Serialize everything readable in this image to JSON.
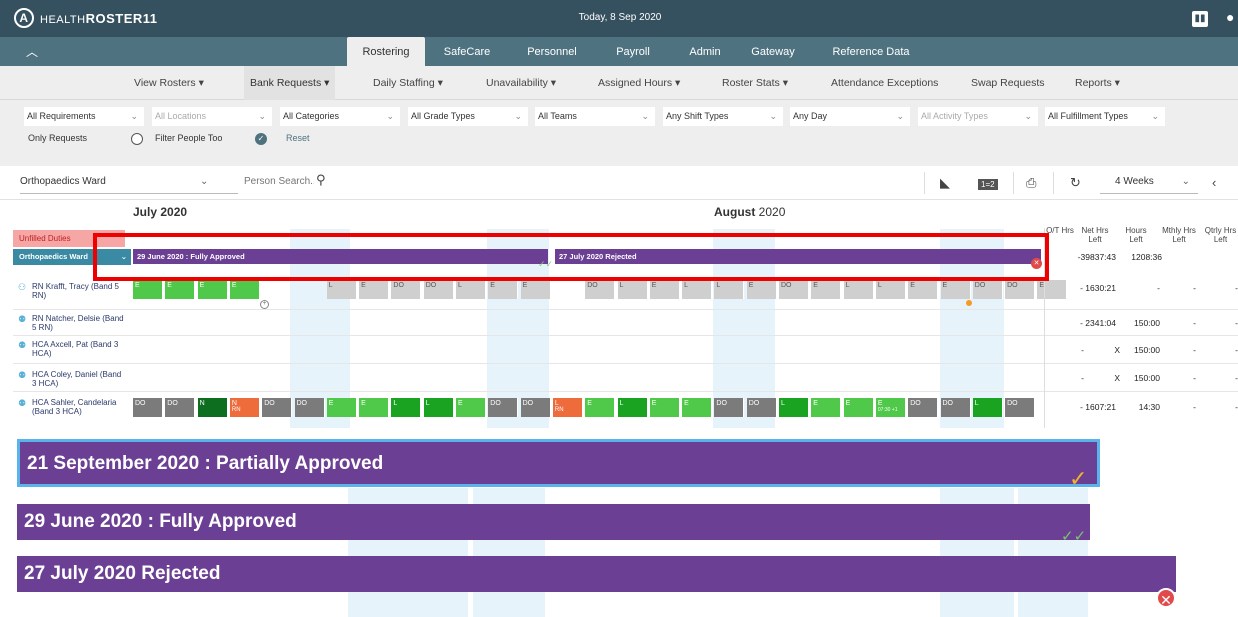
{
  "app": {
    "brand": "HEALTHROSTER11",
    "brand_health": "HEALTH",
    "brand_roster": "ROSTER",
    "brand_num": "11",
    "logo_letter": "A",
    "today": "Today, 8 Sep 2020"
  },
  "tabs": [
    {
      "label": "Rostering",
      "active": true
    },
    {
      "label": "SafeCare"
    },
    {
      "label": "Personnel"
    },
    {
      "label": "Payroll"
    },
    {
      "label": "Admin"
    },
    {
      "label": "Gateway"
    },
    {
      "label": "Reference Data"
    }
  ],
  "submenu": [
    {
      "label": "View Rosters",
      "dropdown": true,
      "active": true
    },
    {
      "label": "Bank Requests",
      "dropdown": true
    },
    {
      "label": "Daily Staffing",
      "dropdown": true
    },
    {
      "label": "Unavailability",
      "dropdown": true
    },
    {
      "label": "Assigned Hours",
      "dropdown": true
    },
    {
      "label": "Roster Stats",
      "dropdown": true
    },
    {
      "label": "Attendance Exceptions"
    },
    {
      "label": "Swap Requests"
    },
    {
      "label": "Reports",
      "dropdown": true
    }
  ],
  "filters": {
    "requirements": "All Requirements",
    "locations": "All Locations",
    "categories": "All Categories",
    "grade_types": "All Grade Types",
    "teams": "All Teams",
    "shift_types": "Any Shift Types",
    "day": "Any Day",
    "activity_types": "All Activity Types",
    "fulfillment_types": "All Fulfillment Types",
    "only_requests": "Only Requests",
    "filter_people_too": "Filter People Too",
    "reset": "Reset"
  },
  "toolbar": {
    "ward": "Orthopaedics Ward",
    "person_search_placeholder": "Person Search...",
    "period": "4 Weeks",
    "one_two": "1=2"
  },
  "months": [
    {
      "name": "July",
      "year": "2020"
    },
    {
      "name": "August",
      "year": "2020"
    }
  ],
  "columns": {
    "ot_hrs": "O/T Hrs",
    "net_hrs": "Net Hrs Left",
    "hours_left": "Hours Left",
    "mthly": "Mthly Hrs Left",
    "qtrly": "Qtrly Hrs Left"
  },
  "left": {
    "unfilled": "Unfilled Duties",
    "ward": "Orthopaedics Ward"
  },
  "periods": [
    {
      "label": "29 June 2020 : Fully Approved",
      "status": "approved"
    },
    {
      "label": "27 July 2020 Rejected",
      "status": "rejected"
    }
  ],
  "ward_totals": {
    "net": "-39837:43",
    "hours": "1208:36"
  },
  "people": [
    {
      "name": "RN Krafft, Tracy (Band 5 RN)",
      "net": "- 1630:21",
      "hours": "-",
      "mthly": "-",
      "qtrly": "-",
      "shifts": [
        "E",
        "E",
        "E",
        "E",
        "",
        "",
        "L",
        "E",
        "DO",
        "DO",
        "L",
        "E",
        "E",
        "",
        "DO",
        "L",
        "E",
        "L",
        "L",
        "E",
        "DO",
        "E",
        "L",
        "L",
        "E",
        "E",
        "DO",
        "DO",
        "E"
      ]
    },
    {
      "name": "RN Natcher, Delsie (Band 5 RN)",
      "net": "- 2341:04",
      "hours": "150:00",
      "mthly": "-",
      "qtrly": "-",
      "shifts": []
    },
    {
      "name": "HCA Axcell, Pat (Band 3 HCA)",
      "net": "-",
      "x": "X",
      "hours": "150:00",
      "mthly": "-",
      "qtrly": "-",
      "shifts": []
    },
    {
      "name": "HCA Coley, Daniel (Band 3 HCA)",
      "net": "-",
      "x": "X",
      "hours": "150:00",
      "mthly": "-",
      "qtrly": "-",
      "shifts": []
    },
    {
      "name": "HCA Sahler, Candelaria (Band 3 HCA)",
      "net": "- 1607:21",
      "hours": "14:30",
      "mthly": "-",
      "qtrly": "-",
      "shifts": [
        "DO",
        "DO",
        "N",
        "N",
        "DO",
        "DO",
        "E",
        "E",
        "L",
        "L",
        "E",
        "DO",
        "DO",
        "L",
        "E",
        "L",
        "E",
        "E",
        "DO",
        "DO",
        "L",
        "E",
        "E",
        "E",
        "DO",
        "DO",
        "L",
        "DO"
      ],
      "notes": {
        "rn": "RN",
        "time": "07:30 +1"
      }
    }
  ],
  "zoom_banners": [
    {
      "label": "21 September 2020 : Partially Approved",
      "status": "partial"
    },
    {
      "label": "29 June 2020 : Fully Approved",
      "status": "approved"
    },
    {
      "label": "27 July 2020 Rejected",
      "status": "rejected"
    }
  ],
  "colors": {
    "topbar": "#35505e",
    "tabbar": "#4f7281",
    "period": "#6b3f93",
    "early": "#50c84a",
    "late": "#19a321",
    "night": "#0d6e1f",
    "day_off": "#7b7b7b",
    "highlight": "#ee0000",
    "weekend": "#e6f3fb"
  }
}
